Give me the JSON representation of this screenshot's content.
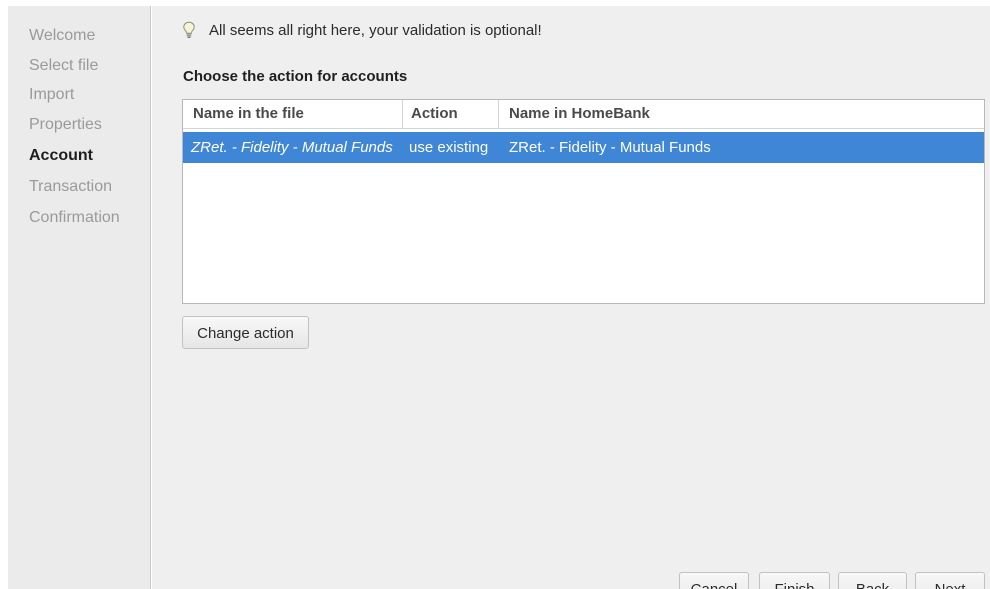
{
  "sidebar": {
    "steps": [
      {
        "label": "Welcome"
      },
      {
        "label": "Select file"
      },
      {
        "label": "Import"
      },
      {
        "label": "Properties"
      },
      {
        "label": "Account"
      },
      {
        "label": "Transaction"
      },
      {
        "label": "Confirmation"
      }
    ],
    "active_step": "Account"
  },
  "info": {
    "icon": "lightbulb-icon",
    "message": "All seems all right here, your validation is optional!"
  },
  "section": {
    "title": "Choose the action for accounts"
  },
  "accounts_table": {
    "columns": [
      "Name in the file",
      "Action",
      "Name in HomeBank"
    ],
    "rows": [
      {
        "name_in_file": "ZRet. - Fidelity - Mutual Funds",
        "action": "use existing",
        "name_in_homebank": "ZRet. - Fidelity - Mutual Funds",
        "selected": true
      }
    ]
  },
  "buttons": {
    "change_action": "Change action",
    "cancel": "Cancel",
    "finish": "Finish",
    "back": "Back",
    "next": "Next"
  },
  "colors": {
    "selection": "#3f86d6",
    "sidebar_bg": "#ebebeb",
    "panel_bg": "#efefef"
  }
}
